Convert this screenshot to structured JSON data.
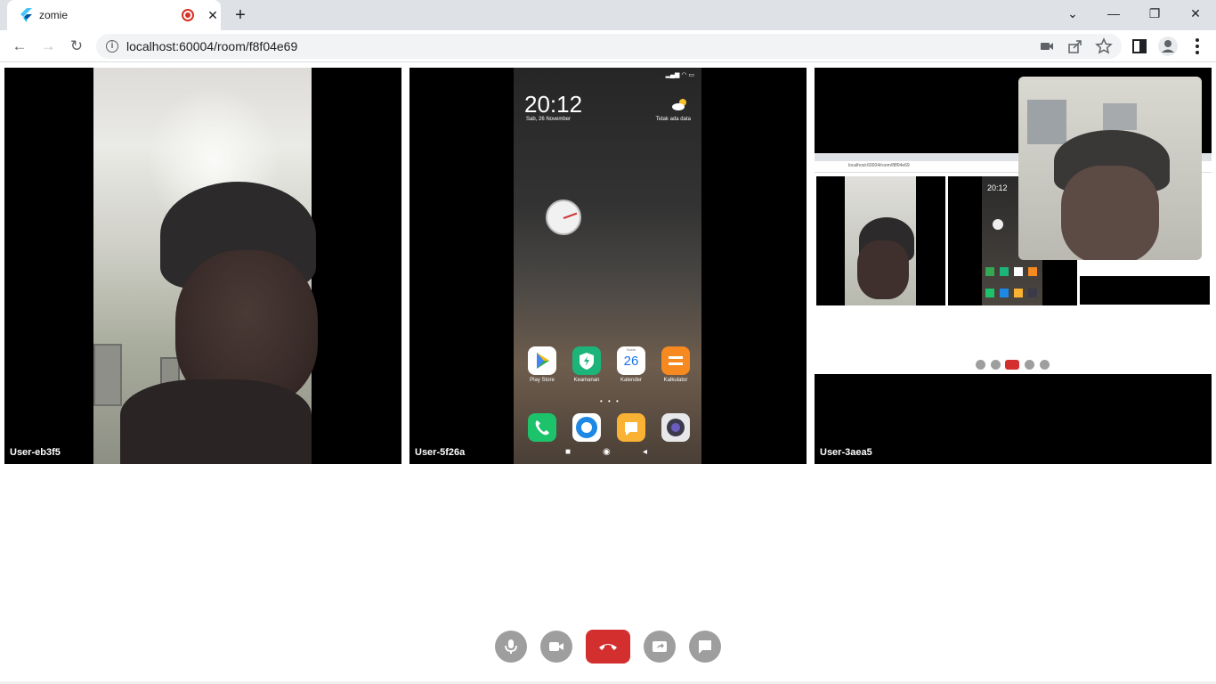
{
  "browser": {
    "tab_title": "zomie",
    "url": "localhost:60004/room/f8f04e69"
  },
  "tiles": [
    {
      "label": "User-eb3f5"
    },
    {
      "label": "User-5f26a"
    },
    {
      "label": "User-3aea5"
    }
  ],
  "phone": {
    "time": "20:12",
    "date": "Sab, 26 November",
    "weather": "Tidak ada data",
    "apps": [
      {
        "label": "Play Store",
        "icon": "play-store-icon",
        "color": "#ffffff"
      },
      {
        "label": "Keamanan",
        "icon": "security-icon",
        "color": "#1db47a"
      },
      {
        "label": "Kalender",
        "icon": "calendar-icon",
        "color": "#ffffff",
        "day": "26",
        "dayname": "Sabtu"
      },
      {
        "label": "Kalkulator",
        "icon": "calculator-icon",
        "color": "#f6891f"
      }
    ],
    "dock": [
      {
        "icon": "phone-icon",
        "color": "#1dc36a"
      },
      {
        "icon": "browser-icon",
        "color": "#ffffff"
      },
      {
        "icon": "messages-icon",
        "color": "#f9b233"
      },
      {
        "icon": "camera-icon",
        "color": "#e8e8ea"
      }
    ]
  },
  "shared_screen": {
    "url": "localhost:60004/room/f8f04e69",
    "time": "20:12"
  },
  "controls": {
    "mic": "mic-icon",
    "camera": "video-camera-icon",
    "hangup": "hang-up-icon",
    "screen_share": "screen-share-icon",
    "chat": "chat-icon",
    "hangup_color": "#d32f2f",
    "button_color": "#9e9e9e"
  }
}
